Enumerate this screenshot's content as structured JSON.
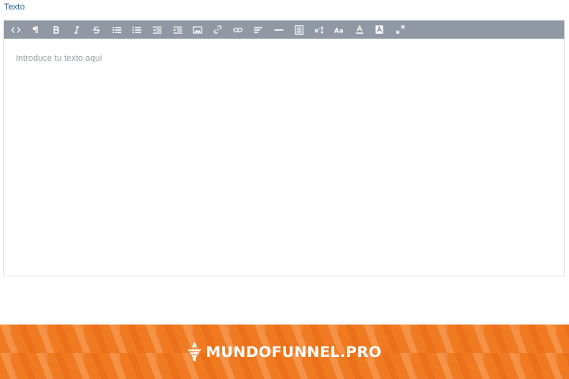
{
  "field": {
    "label": "Texto"
  },
  "editor": {
    "placeholder": "Introduce tu texto aquí",
    "toolbar": [
      {
        "name": "code-view",
        "icon": "code-icon"
      },
      {
        "name": "paragraph",
        "icon": "pilcrow-icon"
      },
      {
        "name": "bold",
        "icon": "bold-icon"
      },
      {
        "name": "italic",
        "icon": "italic-icon"
      },
      {
        "name": "strikethrough",
        "icon": "strikethrough-icon"
      },
      {
        "name": "ordered-list",
        "icon": "ordered-list-icon"
      },
      {
        "name": "unordered-list",
        "icon": "unordered-list-icon"
      },
      {
        "name": "outdent",
        "icon": "outdent-icon"
      },
      {
        "name": "indent",
        "icon": "indent-icon"
      },
      {
        "name": "insert-image",
        "icon": "image-icon"
      },
      {
        "name": "insert-link",
        "icon": "link-icon"
      },
      {
        "name": "unlink",
        "icon": "unlink-icon"
      },
      {
        "name": "align",
        "icon": "align-left-icon"
      },
      {
        "name": "horizontal-rule",
        "icon": "horizontal-rule-icon"
      },
      {
        "name": "format-block",
        "icon": "document-icon"
      },
      {
        "name": "font-size",
        "icon": "font-size-icon"
      },
      {
        "name": "font-family",
        "icon": "font-family-icon"
      },
      {
        "name": "text-color",
        "icon": "text-color-icon"
      },
      {
        "name": "background-color",
        "icon": "background-color-icon"
      },
      {
        "name": "fullscreen",
        "icon": "fullscreen-icon"
      }
    ]
  },
  "banner": {
    "brand_text": "MUNDOFUNNEL.PRO",
    "background_color": "#f07a21"
  },
  "colors": {
    "toolbar_bg": "#8f98a3",
    "label": "#2f5d8a",
    "placeholder": "#9aa0a6"
  }
}
